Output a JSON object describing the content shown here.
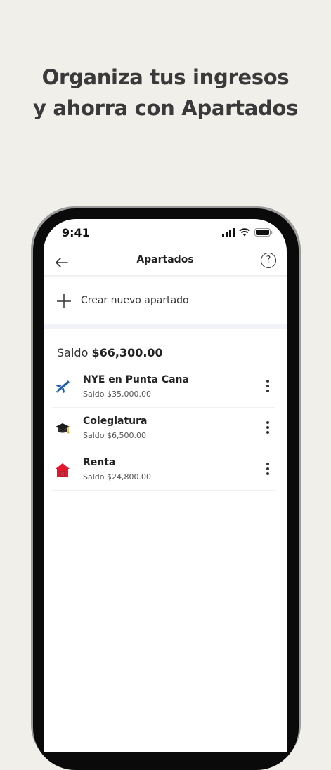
{
  "headline": {
    "line1": "Organiza tus ingresos",
    "line2": "y ahorra con Apartados"
  },
  "status_bar": {
    "time": "9:41"
  },
  "nav": {
    "title": "Apartados",
    "help_glyph": "?"
  },
  "create": {
    "label": "Crear nuevo apartado"
  },
  "total": {
    "label": "Saldo",
    "amount": "$66,300.00"
  },
  "items": [
    {
      "name": "NYE en Punta Cana",
      "balance": "Saldo $35,000.00",
      "icon": "airplane-icon"
    },
    {
      "name": "Colegiatura",
      "balance": "Saldo $6,500.00",
      "icon": "graduation-cap-icon"
    },
    {
      "name": "Renta",
      "balance": "Saldo $24,800.00",
      "icon": "house-icon"
    }
  ],
  "colors": {
    "background": "#f0efea",
    "house_red": "#e3172d",
    "airplane_blue": "#1f5da8"
  }
}
